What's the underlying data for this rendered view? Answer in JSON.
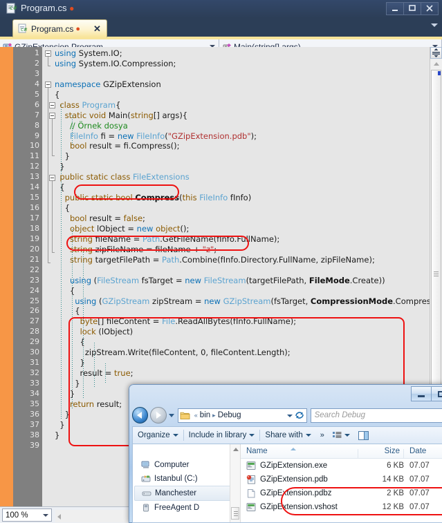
{
  "vs": {
    "window_title": "Program.cs",
    "modified_marker": "●",
    "window_buttons": {
      "minimize": "minimize-icon",
      "maximize": "maximize-icon",
      "close": "close-icon"
    },
    "tab": {
      "label": "Program.cs",
      "modified": "●",
      "close": "✕"
    },
    "navbar": {
      "class_combo": "GZipExtension.Program",
      "member_combo": "Main(string[] args)"
    },
    "status": {
      "zoom": "100 %"
    },
    "line_count": 39,
    "first_line": 1
  },
  "code": {
    "lines": [
      {
        "n": 1,
        "tokens": [
          {
            "t": "using",
            "c": "kw2"
          },
          {
            "t": " System.IO;",
            "c": "pln"
          }
        ]
      },
      {
        "n": 2,
        "tokens": [
          {
            "t": "using",
            "c": "kw2"
          },
          {
            "t": " System.IO.Compression;",
            "c": "pln"
          }
        ]
      },
      {
        "n": 3,
        "tokens": []
      },
      {
        "n": 4,
        "tokens": [
          {
            "t": "namespace",
            "c": "kw2"
          },
          {
            "t": " GZipExtension",
            "c": "pln"
          }
        ]
      },
      {
        "n": 5,
        "tokens": [
          {
            "t": "{",
            "c": "pln"
          }
        ]
      },
      {
        "n": 6,
        "tokens": [
          {
            "t": "  ",
            "c": "pln"
          },
          {
            "t": "class",
            "c": "kw"
          },
          {
            "t": " ",
            "c": "pln"
          },
          {
            "t": "Program",
            "c": "typ"
          },
          {
            "t": "{",
            "c": "pln"
          }
        ]
      },
      {
        "n": 7,
        "tokens": [
          {
            "t": "    ",
            "c": "pln"
          },
          {
            "t": "static",
            "c": "kw"
          },
          {
            "t": " ",
            "c": "pln"
          },
          {
            "t": "void",
            "c": "kw"
          },
          {
            "t": " Main(",
            "c": "pln"
          },
          {
            "t": "string",
            "c": "kw"
          },
          {
            "t": "[] args){",
            "c": "pln"
          }
        ]
      },
      {
        "n": 8,
        "tokens": [
          {
            "t": "      ",
            "c": "pln"
          },
          {
            "t": "// Örnek dosya",
            "c": "cmt"
          }
        ]
      },
      {
        "n": 9,
        "tokens": [
          {
            "t": "      ",
            "c": "pln"
          },
          {
            "t": "FileInfo",
            "c": "typ"
          },
          {
            "t": " fi = ",
            "c": "pln"
          },
          {
            "t": "new",
            "c": "kw2"
          },
          {
            "t": " ",
            "c": "pln"
          },
          {
            "t": "FileInfo",
            "c": "typ"
          },
          {
            "t": "(",
            "c": "pln"
          },
          {
            "t": "\"GZipExtension.pdb\"",
            "c": "str"
          },
          {
            "t": ");",
            "c": "pln"
          }
        ]
      },
      {
        "n": 10,
        "tokens": [
          {
            "t": "      ",
            "c": "pln"
          },
          {
            "t": "bool",
            "c": "kw"
          },
          {
            "t": " result = fi.Compress();",
            "c": "pln"
          }
        ]
      },
      {
        "n": 11,
        "tokens": [
          {
            "t": "    }",
            "c": "pln"
          }
        ]
      },
      {
        "n": 12,
        "tokens": [
          {
            "t": "  }",
            "c": "pln"
          }
        ]
      },
      {
        "n": 13,
        "tokens": [
          {
            "t": "  ",
            "c": "pln"
          },
          {
            "t": "public",
            "c": "kw"
          },
          {
            "t": " ",
            "c": "pln"
          },
          {
            "t": "static",
            "c": "kw"
          },
          {
            "t": " ",
            "c": "pln"
          },
          {
            "t": "class",
            "c": "kw"
          },
          {
            "t": " ",
            "c": "pln"
          },
          {
            "t": "FileExtensions",
            "c": "typ"
          }
        ]
      },
      {
        "n": 14,
        "tokens": [
          {
            "t": "  {",
            "c": "pln"
          }
        ]
      },
      {
        "n": 15,
        "tokens": [
          {
            "t": "    ",
            "c": "pln"
          },
          {
            "t": "public",
            "c": "kw"
          },
          {
            "t": " ",
            "c": "pln"
          },
          {
            "t": "static",
            "c": "kw"
          },
          {
            "t": " ",
            "c": "pln"
          },
          {
            "t": "bool",
            "c": "kw"
          },
          {
            "t": " ",
            "c": "pln"
          },
          {
            "t": "Compress",
            "c": "bld"
          },
          {
            "t": "(",
            "c": "pln"
          },
          {
            "t": "this",
            "c": "kw"
          },
          {
            "t": " ",
            "c": "pln"
          },
          {
            "t": "FileInfo",
            "c": "typ"
          },
          {
            "t": " fInfo)",
            "c": "pln"
          }
        ]
      },
      {
        "n": 16,
        "tokens": [
          {
            "t": "    {",
            "c": "pln"
          }
        ]
      },
      {
        "n": 17,
        "tokens": [
          {
            "t": "      ",
            "c": "pln"
          },
          {
            "t": "bool",
            "c": "kw"
          },
          {
            "t": " result = ",
            "c": "pln"
          },
          {
            "t": "false",
            "c": "kw"
          },
          {
            "t": ";",
            "c": "pln"
          }
        ]
      },
      {
        "n": 18,
        "tokens": [
          {
            "t": "      ",
            "c": "pln"
          },
          {
            "t": "object",
            "c": "kw"
          },
          {
            "t": " lObject = ",
            "c": "pln"
          },
          {
            "t": "new",
            "c": "kw2"
          },
          {
            "t": " ",
            "c": "pln"
          },
          {
            "t": "object",
            "c": "kw"
          },
          {
            "t": "();",
            "c": "pln"
          }
        ]
      },
      {
        "n": 19,
        "tokens": [
          {
            "t": "      ",
            "c": "pln"
          },
          {
            "t": "string",
            "c": "kw"
          },
          {
            "t": " fileName = ",
            "c": "pln"
          },
          {
            "t": "Path",
            "c": "typ"
          },
          {
            "t": ".GetFileName(fInfo.FullName);",
            "c": "pln"
          }
        ]
      },
      {
        "n": 20,
        "tokens": [
          {
            "t": "      ",
            "c": "pln"
          },
          {
            "t": "string",
            "c": "kw"
          },
          {
            "t": " zipFileName = fileName + ",
            "c": "pln"
          },
          {
            "t": "\"z\"",
            "c": "str"
          },
          {
            "t": ";",
            "c": "pln"
          }
        ]
      },
      {
        "n": 21,
        "tokens": [
          {
            "t": "      ",
            "c": "pln"
          },
          {
            "t": "string",
            "c": "kw"
          },
          {
            "t": " targetFilePath = ",
            "c": "pln"
          },
          {
            "t": "Path",
            "c": "typ"
          },
          {
            "t": ".Combine(fInfo.Directory.FullName, zipFileName);",
            "c": "pln"
          }
        ]
      },
      {
        "n": 22,
        "tokens": []
      },
      {
        "n": 23,
        "tokens": [
          {
            "t": "      ",
            "c": "pln"
          },
          {
            "t": "using",
            "c": "kw2"
          },
          {
            "t": " (",
            "c": "pln"
          },
          {
            "t": "FileStream",
            "c": "typ"
          },
          {
            "t": " fsTarget = ",
            "c": "pln"
          },
          {
            "t": "new",
            "c": "kw2"
          },
          {
            "t": " ",
            "c": "pln"
          },
          {
            "t": "FileStream",
            "c": "typ"
          },
          {
            "t": "(targetFilePath, ",
            "c": "pln"
          },
          {
            "t": "FileMode",
            "c": "bld"
          },
          {
            "t": ".Create))",
            "c": "pln"
          }
        ]
      },
      {
        "n": 24,
        "tokens": [
          {
            "t": "      {",
            "c": "pln"
          }
        ]
      },
      {
        "n": 25,
        "tokens": [
          {
            "t": "        ",
            "c": "pln"
          },
          {
            "t": "using",
            "c": "kw2"
          },
          {
            "t": " (",
            "c": "pln"
          },
          {
            "t": "GZipStream",
            "c": "typ"
          },
          {
            "t": " zipStream = ",
            "c": "pln"
          },
          {
            "t": "new",
            "c": "kw2"
          },
          {
            "t": " ",
            "c": "pln"
          },
          {
            "t": "GZipStream",
            "c": "typ"
          },
          {
            "t": "(fsTarget, ",
            "c": "pln"
          },
          {
            "t": "CompressionMode",
            "c": "bld"
          },
          {
            "t": ".Compress))",
            "c": "pln"
          }
        ]
      },
      {
        "n": 26,
        "tokens": [
          {
            "t": "        {",
            "c": "pln"
          }
        ]
      },
      {
        "n": 27,
        "tokens": [
          {
            "t": "          ",
            "c": "pln"
          },
          {
            "t": "byte",
            "c": "kw"
          },
          {
            "t": "[] fileContent = ",
            "c": "pln"
          },
          {
            "t": "File",
            "c": "typ"
          },
          {
            "t": ".ReadAllBytes(fInfo.FullName);",
            "c": "pln"
          }
        ]
      },
      {
        "n": 28,
        "tokens": [
          {
            "t": "          ",
            "c": "pln"
          },
          {
            "t": "lock",
            "c": "kw"
          },
          {
            "t": " (lObject)",
            "c": "pln"
          }
        ]
      },
      {
        "n": 29,
        "tokens": [
          {
            "t": "          {",
            "c": "pln"
          }
        ]
      },
      {
        "n": 30,
        "tokens": [
          {
            "t": "            zipStream.Write(fileContent, 0, fileContent.Length);",
            "c": "pln"
          }
        ]
      },
      {
        "n": 31,
        "tokens": [
          {
            "t": "          }",
            "c": "pln"
          }
        ]
      },
      {
        "n": 32,
        "tokens": [
          {
            "t": "          result = ",
            "c": "pln"
          },
          {
            "t": "true",
            "c": "kw"
          },
          {
            "t": ";",
            "c": "pln"
          }
        ]
      },
      {
        "n": 33,
        "tokens": [
          {
            "t": "        }",
            "c": "pln"
          }
        ]
      },
      {
        "n": 34,
        "tokens": [
          {
            "t": "      }",
            "c": "pln"
          }
        ]
      },
      {
        "n": 35,
        "tokens": [
          {
            "t": "      ",
            "c": "pln"
          },
          {
            "t": "return",
            "c": "kw"
          },
          {
            "t": " result;",
            "c": "pln"
          }
        ]
      },
      {
        "n": 36,
        "tokens": [
          {
            "t": "    }",
            "c": "pln"
          }
        ]
      },
      {
        "n": 37,
        "tokens": [
          {
            "t": "  }",
            "c": "pln"
          }
        ]
      },
      {
        "n": 38,
        "tokens": [
          {
            "t": "}",
            "c": "pln"
          }
        ]
      },
      {
        "n": 39,
        "tokens": []
      }
    ]
  },
  "explorer": {
    "window_buttons": {
      "minimize": "minimize-icon",
      "maximize": "maximize-icon"
    },
    "address": {
      "crumbs": [
        "bin",
        "Debug"
      ],
      "prefix": "«",
      "separator": "▸"
    },
    "search": {
      "placeholder": "Search Debug"
    },
    "toolbar": {
      "organize": "Organize",
      "include_in_library": "Include in library",
      "share_with": "Share with",
      "more": "»"
    },
    "tree": [
      {
        "label": "Computer",
        "icon": "computer-icon",
        "selected": false
      },
      {
        "label": "Istanbul (C:)",
        "icon": "system-drive-icon",
        "selected": false
      },
      {
        "label": "Manchester",
        "icon": "drive-icon",
        "selected": true
      },
      {
        "label": "FreeAgent D",
        "icon": "usb-drive-icon",
        "selected": false
      }
    ],
    "columns": {
      "name": "Name",
      "size": "Size",
      "date": "Date"
    },
    "files": [
      {
        "name": "GZipExtension.exe",
        "size": "6 KB",
        "date": "07.07",
        "icon": "exe-icon",
        "highlighted": false
      },
      {
        "name": "GZipExtension.pdb",
        "size": "14 KB",
        "date": "07.07",
        "icon": "pdb-icon",
        "highlighted": true
      },
      {
        "name": "GZipExtension.pdbz",
        "size": "2 KB",
        "date": "07.07",
        "icon": "blank-icon",
        "highlighted": true
      },
      {
        "name": "GZipExtension.vshost",
        "size": "12 KB",
        "date": "07.07",
        "icon": "exe-icon",
        "highlighted": false
      }
    ]
  },
  "annotations": {
    "color": "#ee1111",
    "regions": [
      "bool-result-compress-line",
      "compress-method-signature",
      "using-block",
      "pdb-and-pdbz-files"
    ]
  }
}
